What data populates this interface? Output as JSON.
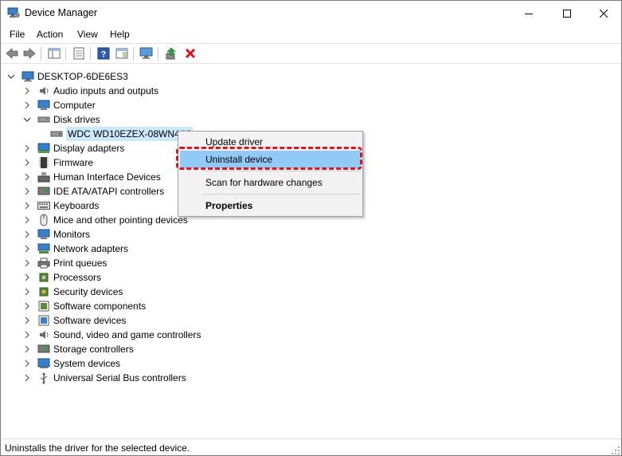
{
  "window": {
    "title": "Device Manager"
  },
  "menu": [
    "File",
    "Action",
    "View",
    "Help"
  ],
  "tree": {
    "root": "DESKTOP-6DE6ES3",
    "categories": [
      "Audio inputs and outputs",
      "Computer",
      "Disk drives",
      "Display adapters",
      "Firmware",
      "Human Interface Devices",
      "IDE ATA/ATAPI controllers",
      "Keyboards",
      "Mice and other pointing devices",
      "Monitors",
      "Network adapters",
      "Print queues",
      "Processors",
      "Security devices",
      "Software components",
      "Software devices",
      "Sound, video and game controllers",
      "Storage controllers",
      "System devices",
      "Universal Serial Bus controllers"
    ],
    "disk_child": "WDC WD10EZEX-08WN4A0"
  },
  "context_menu": {
    "update": "Update driver",
    "uninstall": "Uninstall device",
    "scan": "Scan for hardware changes",
    "properties": "Properties"
  },
  "status": {
    "text": "Uninstalls the driver for the selected device."
  },
  "colors": {
    "selection": "#cce8ff",
    "menu_highlight": "#91c9f7",
    "annotation": "#e0141e"
  }
}
